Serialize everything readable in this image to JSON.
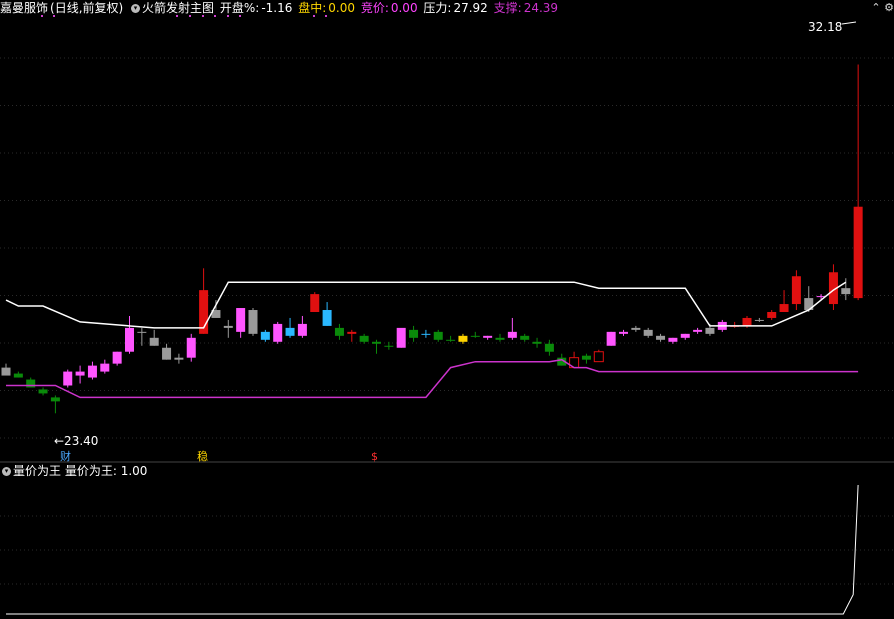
{
  "header": {
    "stock_name": "嘉曼服饰",
    "period": "(日线,前复权)",
    "indicator_name": "火箭发射主图",
    "open_pct_label": "开盘%:",
    "open_pct_value": "-1.16",
    "intraday_label": "盘中:",
    "intraday_value": "0.00",
    "bid_label": "竞价:",
    "bid_value": "0.00",
    "pressure_label": "压力:",
    "pressure_value": "27.92",
    "support_label": "支撑:",
    "support_value": "24.39"
  },
  "sub_indicator": {
    "name": "量价为王",
    "label": "量价为王:",
    "value": "1.00"
  },
  "annotations": {
    "high_price": "32.18",
    "low_price": "23.40",
    "marker_cai": "财",
    "marker_wen": "稳",
    "marker_s": "$"
  },
  "colors": {
    "up_red": "#e01010",
    "down_green": "#0a8a0a",
    "pink": "#ff55ff",
    "gray": "#9a9a9a",
    "cyan": "#2ab8ff",
    "yellow": "#ffd400",
    "pressure_line": "#ffffff",
    "support_line": "#cc33cc"
  },
  "chart_data": {
    "type": "candlestick",
    "ylim": [
      22.3,
      33.3
    ],
    "candles": [
      {
        "o": 24.55,
        "h": 24.65,
        "l": 24.35,
        "c": 24.35,
        "color": "gray"
      },
      {
        "o": 24.4,
        "h": 24.45,
        "l": 24.3,
        "c": 24.3,
        "color": "down_green"
      },
      {
        "o": 24.25,
        "h": 24.3,
        "l": 24.05,
        "c": 24.05,
        "color": "down_green"
      },
      {
        "o": 24.0,
        "h": 24.05,
        "l": 23.85,
        "c": 23.9,
        "color": "down_green"
      },
      {
        "o": 23.8,
        "h": 23.85,
        "l": 23.4,
        "c": 23.7,
        "color": "down_green"
      },
      {
        "o": 24.1,
        "h": 24.5,
        "l": 24.05,
        "c": 24.45,
        "color": "pink"
      },
      {
        "o": 24.35,
        "h": 24.6,
        "l": 24.15,
        "c": 24.45,
        "color": "pink"
      },
      {
        "o": 24.3,
        "h": 24.7,
        "l": 24.25,
        "c": 24.6,
        "color": "pink"
      },
      {
        "o": 24.45,
        "h": 24.75,
        "l": 24.4,
        "c": 24.65,
        "color": "pink"
      },
      {
        "o": 24.65,
        "h": 24.95,
        "l": 24.6,
        "c": 24.95,
        "color": "pink"
      },
      {
        "o": 24.95,
        "h": 25.85,
        "l": 24.9,
        "c": 25.55,
        "color": "pink"
      },
      {
        "o": 25.45,
        "h": 25.55,
        "l": 25.1,
        "c": 25.45,
        "color": "gray"
      },
      {
        "o": 25.3,
        "h": 25.5,
        "l": 25.1,
        "c": 25.1,
        "color": "gray"
      },
      {
        "o": 25.05,
        "h": 25.15,
        "l": 24.75,
        "c": 24.75,
        "color": "gray"
      },
      {
        "o": 24.8,
        "h": 24.9,
        "l": 24.65,
        "c": 24.75,
        "color": "gray"
      },
      {
        "o": 24.8,
        "h": 25.4,
        "l": 24.7,
        "c": 25.3,
        "color": "pink"
      },
      {
        "o": 25.4,
        "h": 27.05,
        "l": 25.4,
        "c": 26.5,
        "color": "up_red"
      },
      {
        "o": 26.0,
        "h": 26.25,
        "l": 25.9,
        "c": 25.8,
        "color": "gray"
      },
      {
        "o": 25.6,
        "h": 25.75,
        "l": 25.3,
        "c": 25.55,
        "color": "gray"
      },
      {
        "o": 25.45,
        "h": 26.05,
        "l": 25.3,
        "c": 26.05,
        "color": "pink"
      },
      {
        "o": 25.4,
        "h": 26.05,
        "l": 25.35,
        "c": 26.0,
        "color": "gray"
      },
      {
        "o": 25.25,
        "h": 25.5,
        "l": 25.2,
        "c": 25.45,
        "color": "cyan"
      },
      {
        "o": 25.2,
        "h": 25.7,
        "l": 25.15,
        "c": 25.65,
        "color": "pink"
      },
      {
        "o": 25.35,
        "h": 25.8,
        "l": 25.3,
        "c": 25.55,
        "color": "cyan"
      },
      {
        "o": 25.35,
        "h": 25.85,
        "l": 25.3,
        "c": 25.65,
        "color": "pink"
      },
      {
        "o": 25.95,
        "h": 26.45,
        "l": 25.95,
        "c": 26.4,
        "color": "up_red"
      },
      {
        "o": 26.0,
        "h": 26.2,
        "l": 25.6,
        "c": 25.6,
        "color": "cyan"
      },
      {
        "o": 25.55,
        "h": 25.65,
        "l": 25.25,
        "c": 25.35,
        "color": "down_green"
      },
      {
        "o": 25.45,
        "h": 25.5,
        "l": 25.2,
        "c": 25.4,
        "color": "up_red"
      },
      {
        "o": 25.35,
        "h": 25.4,
        "l": 25.15,
        "c": 25.2,
        "color": "down_green"
      },
      {
        "o": 25.2,
        "h": 25.25,
        "l": 24.9,
        "c": 25.15,
        "color": "down_green"
      },
      {
        "o": 25.1,
        "h": 25.2,
        "l": 25.0,
        "c": 25.1,
        "color": "down_green"
      },
      {
        "o": 25.05,
        "h": 25.5,
        "l": 25.05,
        "c": 25.55,
        "color": "pink"
      },
      {
        "o": 25.5,
        "h": 25.6,
        "l": 25.2,
        "c": 25.3,
        "color": "down_green"
      },
      {
        "o": 25.4,
        "h": 25.5,
        "l": 25.3,
        "c": 25.4,
        "color": "cyan"
      },
      {
        "o": 25.45,
        "h": 25.5,
        "l": 25.2,
        "c": 25.25,
        "color": "down_green"
      },
      {
        "o": 25.25,
        "h": 25.35,
        "l": 25.2,
        "c": 25.25,
        "color": "down_green"
      },
      {
        "o": 25.2,
        "h": 25.4,
        "l": 25.15,
        "c": 25.35,
        "color": "yellow"
      },
      {
        "o": 25.35,
        "h": 25.45,
        "l": 25.3,
        "c": 25.35,
        "color": "down_green"
      },
      {
        "o": 25.3,
        "h": 25.35,
        "l": 25.25,
        "c": 25.35,
        "color": "pink"
      },
      {
        "o": 25.3,
        "h": 25.4,
        "l": 25.2,
        "c": 25.25,
        "color": "down_green"
      },
      {
        "o": 25.3,
        "h": 25.8,
        "l": 25.25,
        "c": 25.45,
        "color": "pink"
      },
      {
        "o": 25.35,
        "h": 25.4,
        "l": 25.2,
        "c": 25.25,
        "color": "down_green"
      },
      {
        "o": 25.2,
        "h": 25.3,
        "l": 25.05,
        "c": 25.15,
        "color": "down_green"
      },
      {
        "o": 25.15,
        "h": 25.25,
        "l": 24.85,
        "c": 24.95,
        "color": "down_green"
      },
      {
        "o": 24.8,
        "h": 24.9,
        "l": 24.6,
        "c": 24.6,
        "color": "down_green"
      },
      {
        "o": 24.55,
        "h": 24.95,
        "l": 24.55,
        "c": 24.8,
        "color": "hollow_red"
      },
      {
        "o": 24.85,
        "h": 24.9,
        "l": 24.65,
        "c": 24.75,
        "color": "down_green"
      },
      {
        "o": 24.7,
        "h": 25.0,
        "l": 24.7,
        "c": 24.95,
        "color": "hollow_red"
      },
      {
        "o": 25.1,
        "h": 25.45,
        "l": 25.1,
        "c": 25.45,
        "color": "pink"
      },
      {
        "o": 25.4,
        "h": 25.5,
        "l": 25.35,
        "c": 25.45,
        "color": "pink"
      },
      {
        "o": 25.5,
        "h": 25.6,
        "l": 25.45,
        "c": 25.55,
        "color": "gray"
      },
      {
        "o": 25.5,
        "h": 25.55,
        "l": 25.3,
        "c": 25.35,
        "color": "gray"
      },
      {
        "o": 25.35,
        "h": 25.4,
        "l": 25.2,
        "c": 25.25,
        "color": "gray"
      },
      {
        "o": 25.2,
        "h": 25.3,
        "l": 25.15,
        "c": 25.3,
        "color": "pink"
      },
      {
        "o": 25.3,
        "h": 25.4,
        "l": 25.25,
        "c": 25.4,
        "color": "pink"
      },
      {
        "o": 25.45,
        "h": 25.55,
        "l": 25.4,
        "c": 25.5,
        "color": "pink"
      },
      {
        "o": 25.55,
        "h": 25.65,
        "l": 25.35,
        "c": 25.4,
        "color": "gray"
      },
      {
        "o": 25.5,
        "h": 25.75,
        "l": 25.45,
        "c": 25.7,
        "color": "pink"
      },
      {
        "o": 25.6,
        "h": 25.7,
        "l": 25.55,
        "c": 25.6,
        "color": "up_red"
      },
      {
        "o": 25.6,
        "h": 25.85,
        "l": 25.55,
        "c": 25.8,
        "color": "up_red"
      },
      {
        "o": 25.75,
        "h": 25.8,
        "l": 25.7,
        "c": 25.75,
        "color": "gray"
      },
      {
        "o": 25.8,
        "h": 26.0,
        "l": 25.75,
        "c": 25.95,
        "color": "up_red"
      },
      {
        "o": 25.95,
        "h": 26.5,
        "l": 25.95,
        "c": 26.15,
        "color": "up_red"
      },
      {
        "o": 26.15,
        "h": 27.0,
        "l": 26.0,
        "c": 26.85,
        "color": "up_red"
      },
      {
        "o": 26.3,
        "h": 26.6,
        "l": 25.95,
        "c": 26.0,
        "color": "gray"
      },
      {
        "o": 26.35,
        "h": 26.4,
        "l": 26.25,
        "c": 26.35,
        "color": "pink"
      },
      {
        "o": 26.15,
        "h": 27.15,
        "l": 26.0,
        "c": 26.95,
        "color": "up_red"
      },
      {
        "o": 26.55,
        "h": 26.8,
        "l": 26.25,
        "c": 26.4,
        "color": "gray"
      },
      {
        "o": 26.3,
        "h": 32.18,
        "l": 26.25,
        "c": 28.6,
        "color": "up_red"
      }
    ],
    "pressure_line": [
      [
        0,
        26.25
      ],
      [
        1,
        26.1
      ],
      [
        3,
        26.1
      ],
      [
        6,
        25.7
      ],
      [
        8,
        25.65
      ],
      [
        12,
        25.55
      ],
      [
        16,
        25.55
      ],
      [
        18,
        26.7
      ],
      [
        46,
        26.7
      ],
      [
        48,
        26.55
      ],
      [
        55,
        26.55
      ],
      [
        57,
        25.6
      ],
      [
        62,
        25.6
      ],
      [
        65,
        26.0
      ],
      [
        67,
        26.5
      ],
      [
        68,
        26.7
      ]
    ],
    "support_line": [
      [
        0,
        24.1
      ],
      [
        4,
        24.1
      ],
      [
        6,
        23.8
      ],
      [
        34,
        23.8
      ],
      [
        36,
        24.55
      ],
      [
        38,
        24.7
      ],
      [
        44,
        24.7
      ],
      [
        45,
        24.75
      ],
      [
        46,
        24.55
      ],
      [
        47,
        24.55
      ],
      [
        48,
        24.45
      ],
      [
        69,
        24.45
      ]
    ],
    "sub_line": [
      [
        0,
        0.0
      ],
      [
        14.8,
        0.0
      ],
      [
        16.8,
        0.0
      ],
      [
        67.8,
        0.0
      ],
      [
        68.6,
        0.15
      ],
      [
        69,
        1.0
      ]
    ]
  }
}
